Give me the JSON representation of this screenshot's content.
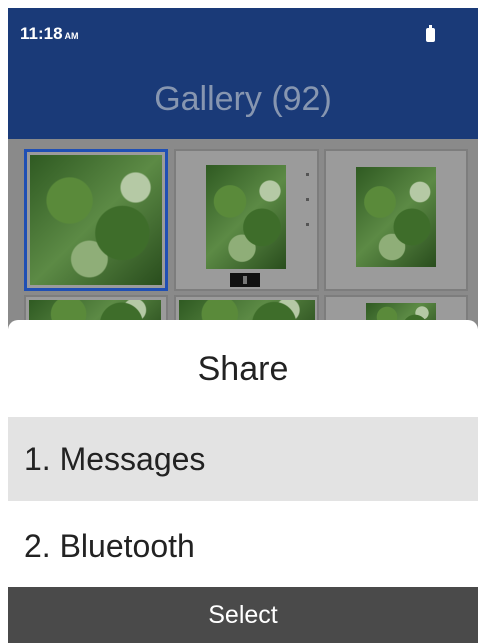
{
  "status_bar": {
    "time": "11:18",
    "ampm": "AM",
    "battery_icon": "battery-icon"
  },
  "header": {
    "title": "Gallery (92)",
    "color": "#1a3a78"
  },
  "gallery": {
    "selected_index": 0
  },
  "dialog": {
    "title": "Share",
    "items": [
      {
        "label": "1. Messages",
        "focused": true
      },
      {
        "label": "2. Bluetooth",
        "focused": false
      }
    ]
  },
  "softkey": {
    "center_label": "Select"
  }
}
